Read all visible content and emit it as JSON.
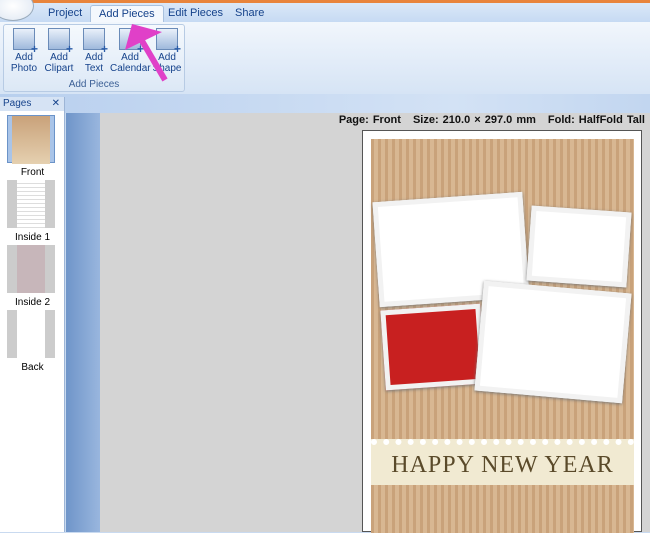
{
  "tabs": [
    {
      "label": "Project"
    },
    {
      "label": "Add Pieces"
    },
    {
      "label": "Edit Pieces"
    },
    {
      "label": "Share"
    }
  ],
  "ribbon": {
    "group_label": "Add Pieces",
    "buttons": [
      {
        "line1": "Add",
        "line2": "Photo"
      },
      {
        "line1": "Add",
        "line2": "Clipart"
      },
      {
        "line1": "Add",
        "line2": "Text"
      },
      {
        "line1": "Add",
        "line2": "Calendar"
      },
      {
        "line1": "Add",
        "line2": "Shape"
      }
    ]
  },
  "pages_panel": {
    "title": "Pages",
    "close": "✕",
    "pages": [
      {
        "label": "Front"
      },
      {
        "label": "Inside 1"
      },
      {
        "label": "Inside 2"
      },
      {
        "label": "Back"
      }
    ]
  },
  "info_bar": {
    "page": "Page: Front",
    "size": "Size: 210.0 × 297.0 mm",
    "fold": "Fold: HalfFold Tall"
  },
  "card": {
    "greeting": "HAPPY NEW YEAR"
  },
  "colors": {
    "accent_arrow": "#e040c8",
    "tab_text": "#15428b"
  }
}
